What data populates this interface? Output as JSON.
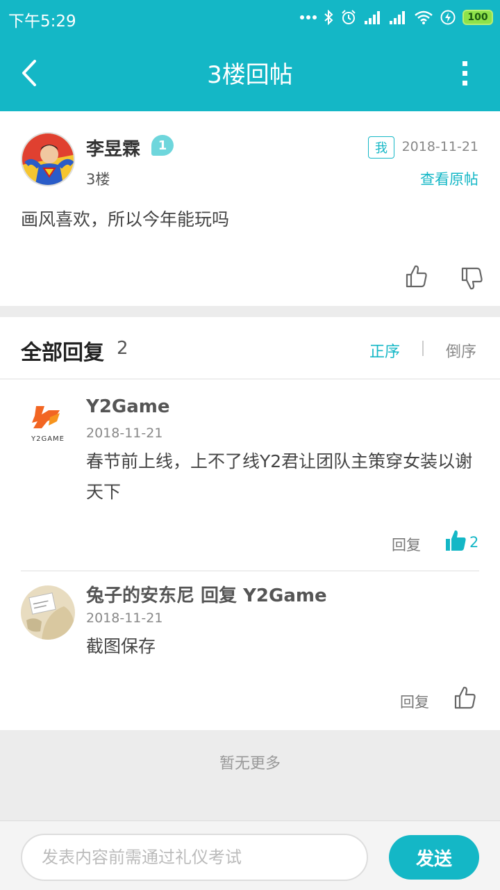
{
  "status": {
    "time": "下午5:29",
    "battery": "100"
  },
  "header": {
    "title": "3楼回帖"
  },
  "post": {
    "author": "李昱霖",
    "level": "1",
    "me_tag": "我",
    "date": "2018-11-21",
    "floor": "3楼",
    "view_original": "查看原帖",
    "content": "画风喜欢，所以今年能玩吗"
  },
  "replies": {
    "title": "全部回复",
    "count": "2",
    "sort_asc": "正序",
    "sort_desc": "倒序",
    "items": [
      {
        "author": "Y2Game",
        "date": "2018-11-21",
        "content": "春节前上线，上不了线Y2君让团队主策穿女装以谢天下",
        "reply_label": "回复",
        "likes": "2",
        "logo_text": "Y2GAME"
      },
      {
        "author": "兔子的安东尼 回复 Y2Game",
        "date": "2018-11-21",
        "content": "截图保存",
        "reply_label": "回复"
      }
    ]
  },
  "footer": {
    "no_more": "暂无更多"
  },
  "composer": {
    "placeholder": "发表内容前需通过礼仪考试",
    "send_label": "发送"
  },
  "colors": {
    "accent": "#14b7c6",
    "page_bg": "#ececec"
  }
}
